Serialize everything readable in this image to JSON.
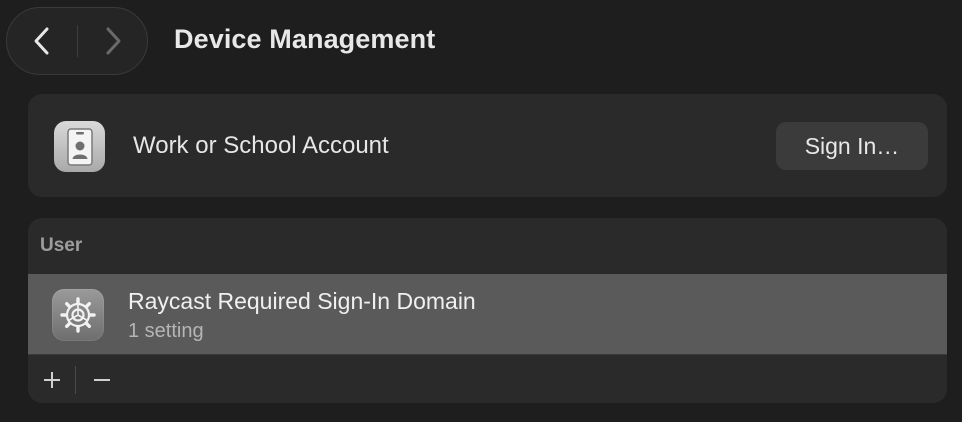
{
  "toolbar": {
    "back_icon": "chevron-left-icon",
    "forward_icon": "chevron-right-icon",
    "title": "Device Management"
  },
  "account": {
    "icon": "id-badge-icon",
    "label": "Work or School Account",
    "sign_in_label": "Sign In…"
  },
  "profiles": {
    "section_title": "User",
    "items": [
      {
        "icon": "gear-icon",
        "name": "Raycast Required Sign-In Domain",
        "detail": "1 setting",
        "selected": true
      }
    ],
    "add_label": "+",
    "remove_label": "−"
  },
  "colors": {
    "background": "#1e1e1e",
    "card": "#2a2a2a",
    "selected_row": "#5a5a5a",
    "button": "#3b3b3b"
  }
}
